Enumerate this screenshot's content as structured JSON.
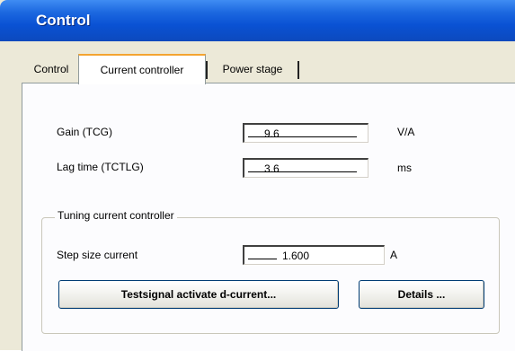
{
  "window": {
    "title": "Control"
  },
  "tabs": [
    {
      "label": "Control"
    },
    {
      "label": "Current controller"
    },
    {
      "label": "Power stage"
    }
  ],
  "fields": {
    "gain": {
      "label": "Gain (TCG)",
      "value": "9.6",
      "unit": "V/A"
    },
    "lag_time": {
      "label": "Lag time (TCTLG)",
      "value": "3.6",
      "unit": "ms"
    }
  },
  "tuning_group": {
    "title": "Tuning current controller",
    "step_size": {
      "label": "Step size current",
      "value": "1.600",
      "unit": "A"
    },
    "testsignal_button": "Testsignal activate d-current...",
    "details_button": "Details ..."
  }
}
